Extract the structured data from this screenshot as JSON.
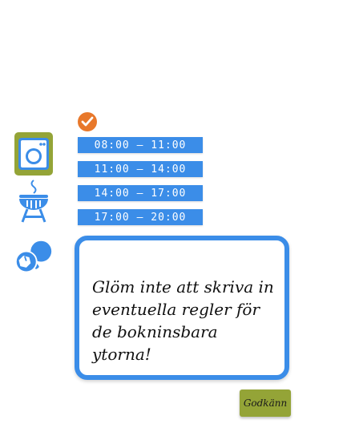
{
  "facilities": [
    {
      "name": "laundry",
      "icon": "washing-machine-icon",
      "selected": true
    },
    {
      "name": "grill",
      "icon": "grill-icon",
      "selected": false
    },
    {
      "name": "sports",
      "icon": "ball-and-paddle-icon",
      "selected": false
    }
  ],
  "clock_icon": "clock-icon",
  "time_slots": [
    {
      "label": "08:00 – 11:00"
    },
    {
      "label": "11:00 – 14:00"
    },
    {
      "label": "14:00 – 17:00"
    },
    {
      "label": "17:00 – 20:00"
    }
  ],
  "note": {
    "text": "Glöm inte att skriva in eventuella regler för de bokninsbara ytorna!"
  },
  "approve_button": {
    "label": "Godkänn"
  },
  "colors": {
    "accent_blue": "#3b8de8",
    "accent_green": "#94a437",
    "clock_orange": "#e8782b"
  }
}
